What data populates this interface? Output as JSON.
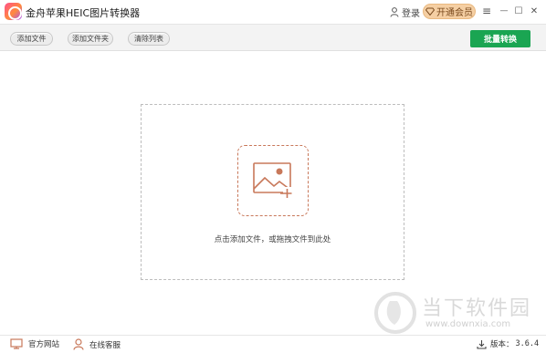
{
  "titlebar": {
    "title": "金舟苹果HEIC图片转换器",
    "login_label": "登录",
    "vip_label": "开通会员",
    "accent_color": "#f5cfa3"
  },
  "window_controls": {
    "menu": "≡",
    "minimize": "—",
    "maximize": "☐",
    "close": "✕"
  },
  "toolbar": {
    "add_file": "添加文件",
    "add_folder": "添加文件夹",
    "clear_list": "清除列表",
    "batch_convert": "批量转换",
    "batch_color": "#1aa552"
  },
  "main": {
    "drop_hint": "点击添加文件，或拖拽文件到此处"
  },
  "watermark": {
    "brand": "当下软件园",
    "url": "www.downxia.com"
  },
  "footer": {
    "website": "官方网站",
    "support": "在线客服",
    "version_label": "版本：",
    "version_num": "3.6.4"
  },
  "icons": [
    "app-logo-icon",
    "user-icon",
    "diamond-icon",
    "image-add-icon",
    "monitor-icon",
    "headset-icon",
    "download-icon"
  ]
}
